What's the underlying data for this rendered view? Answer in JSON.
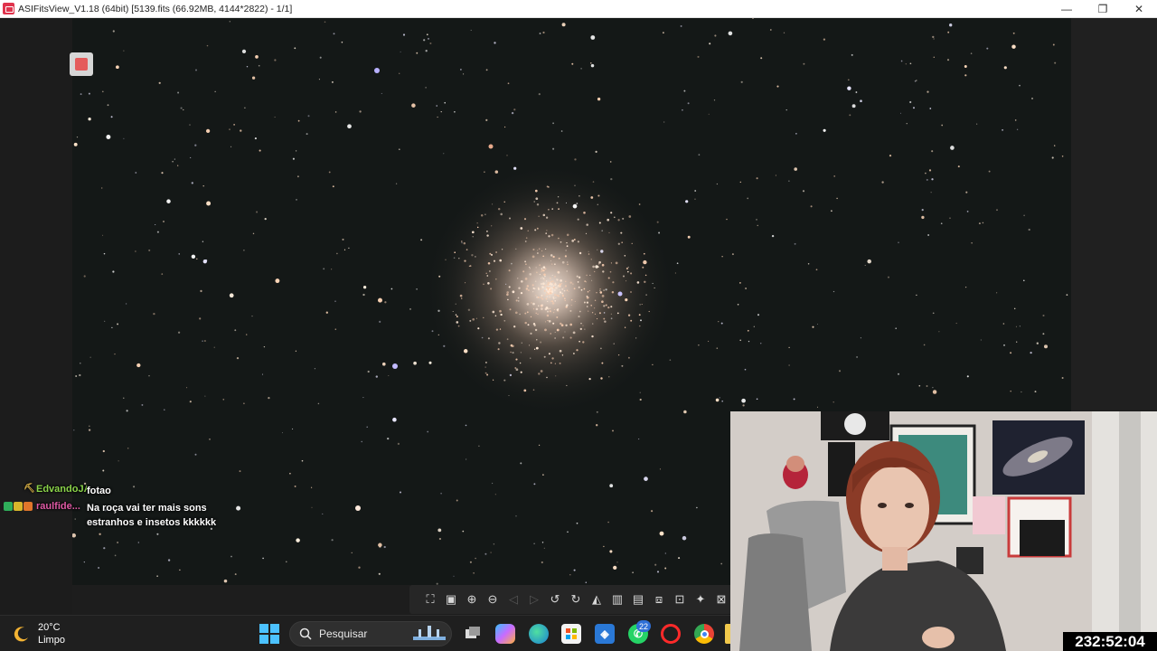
{
  "window": {
    "title": "ASIFitsView_V1.18 (64bit) [5139.fits (66.92MB, 4144*2822) - 1/1]",
    "controls": {
      "minimize": "—",
      "restore": "❐",
      "close": "✕"
    }
  },
  "chat": [
    {
      "user": "EdvandoJA",
      "user_color": "#8bd44a",
      "message": "fotao",
      "badges": [
        "#2b2b2b"
      ]
    },
    {
      "user": "raulfide...",
      "user_color": "#e05aa5",
      "message": "Na roça vai ter mais sons estranhos e insetos kkkkkk",
      "badges": [
        "#2fae5a",
        "#d8b62b",
        "#e0762b"
      ]
    }
  ],
  "toolbar": {
    "icons": [
      "fit-screen-icon",
      "actual-size-icon",
      "zoom-in-icon",
      "zoom-out-icon",
      "previous-icon",
      "next-icon",
      "rotate-left-icon",
      "rotate-right-icon",
      "histogram-icon",
      "delete-icon",
      "save-icon",
      "stretch-icon",
      "info-icon",
      "star-icon",
      "crop-icon"
    ]
  },
  "taskbar": {
    "weather_temp": "20°C",
    "weather_desc": "Limpo",
    "search_placeholder": "Pesquisar",
    "whatsapp_badge": "22"
  },
  "stream": {
    "timer": "232:52:04"
  },
  "colors": {
    "accent": "#4cc2ff",
    "sky": "#141817"
  }
}
